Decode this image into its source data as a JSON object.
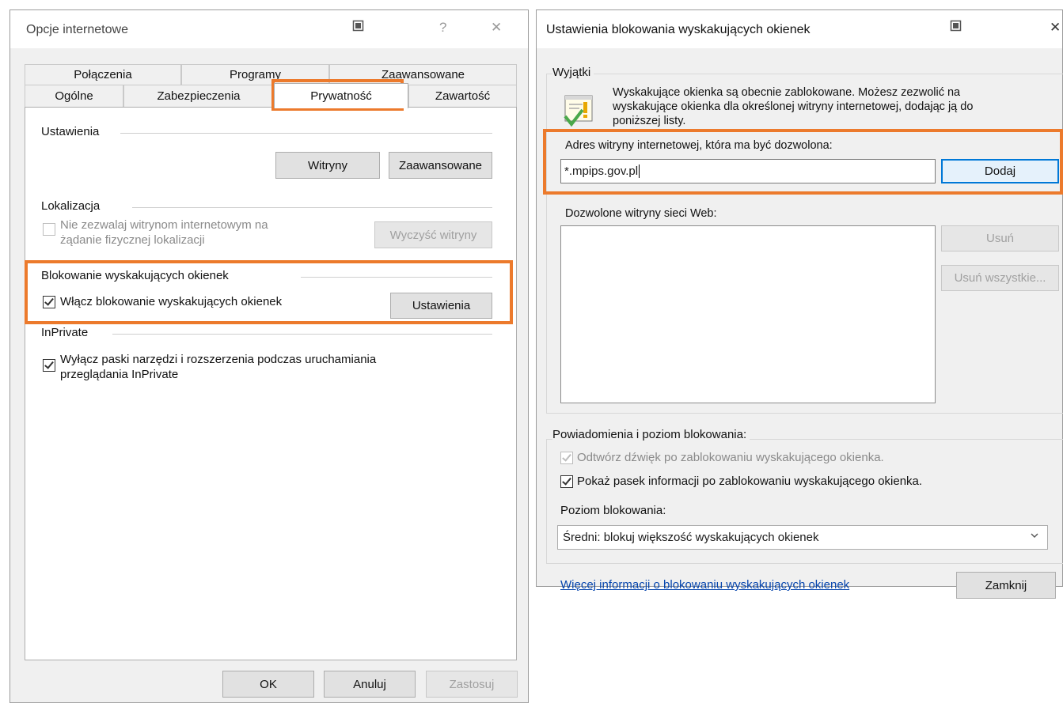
{
  "left_window": {
    "title": "Opcje internetowe",
    "pin_icon": "pin-icon",
    "help": "?",
    "close": "✕",
    "tabs_row1": [
      "Połączenia",
      "Programy",
      "Zaawansowane"
    ],
    "tabs_row2": [
      "Ogólne",
      "Zabezpieczenia",
      "Prywatność",
      "Zawartość"
    ],
    "settings": {
      "title": "Ustawienia",
      "sites_button": "Witryny",
      "advanced_button": "Zaawansowane"
    },
    "location": {
      "title": "Lokalizacja",
      "checkbox_label_1": "Nie zezwalaj witrynom internetowym na",
      "checkbox_label_2": "żądanie fizycznej lokalizacji",
      "checked": false,
      "clear_button": "Wyczyść witryny"
    },
    "popup": {
      "title": "Blokowanie wyskakujących okienek",
      "checkbox_label": "Włącz blokowanie wyskakujących okienek",
      "checked": true,
      "settings_button": "Ustawienia"
    },
    "inprivate": {
      "title": "InPrivate",
      "checkbox_label_1": "Wyłącz paski narzędzi i rozszerzenia podczas uruchamiania",
      "checkbox_label_2": "przeglądania InPrivate",
      "checked": true
    },
    "footer": {
      "ok": "OK",
      "cancel": "Anuluj",
      "apply": "Zastosuj"
    }
  },
  "right_window": {
    "title": "Ustawienia blokowania wyskakujących okienek",
    "close": "✕",
    "exceptions": {
      "title": "Wyjątki",
      "info_1": "Wyskakujące okienka są obecnie zablokowane. Możesz zezwolić na",
      "info_2": "wyskakujące okienka dla określonej witryny internetowej, dodając ją do",
      "info_3": "poniższej listy.",
      "address_label": "Adres witryny internetowej, która ma być dozwolona:",
      "address_value": "*.mpips.gov.pl",
      "add_button": "Dodaj",
      "allowed_label": "Dozwolone witryny sieci Web:",
      "remove_button": "Usuń",
      "remove_all_button": "Usuń wszystkie..."
    },
    "notifications": {
      "title": "Powiadomienia i poziom blokowania:",
      "sound_label": "Odtwórz dźwięk po zablokowaniu wyskakującego okienka.",
      "sound_checked": true,
      "infobar_label": "Pokaż pasek informacji po zablokowaniu wyskakującego okienka.",
      "infobar_checked": true,
      "level_label": "Poziom blokowania:",
      "level_value": "Średni: blokuj większość wyskakujących okienek"
    },
    "more_info_link": "Więcej informacji o blokowaniu wyskakujących okienek",
    "close_button": "Zamknij"
  },
  "colors": {
    "highlight": "#ec7a2c",
    "link": "#0645ad",
    "accent": "#0078d7"
  }
}
